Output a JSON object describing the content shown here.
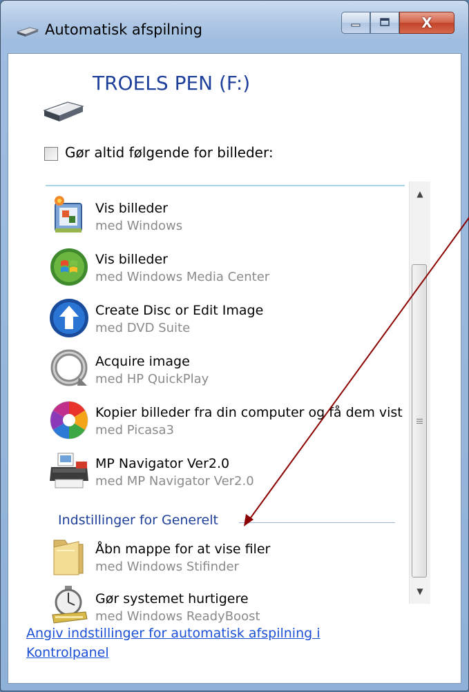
{
  "window": {
    "title": "Automatisk afspilning",
    "minimize_icon": "minimize-icon",
    "maximize_icon": "maximize-icon",
    "close_label": "X"
  },
  "device": {
    "name": "TROELS PEN (F:)",
    "icon": "usb-drive-icon"
  },
  "always_option": {
    "label": "Gør altid følgende for billeder:",
    "checked": false
  },
  "actions": [
    {
      "title": "Vis billeder",
      "subtitle": "med Windows",
      "icon": "photo-gallery-icon"
    },
    {
      "title": "Vis billeder",
      "subtitle": "med Windows Media Center",
      "icon": "media-center-icon"
    },
    {
      "title": "Create Disc or Edit Image",
      "subtitle": "med DVD Suite",
      "icon": "dvd-suite-icon"
    },
    {
      "title": "Acquire image",
      "subtitle": "med HP QuickPlay",
      "icon": "hp-quickplay-icon"
    },
    {
      "title": "Kopier billeder fra din computer og få dem vist",
      "subtitle": "med Picasa3",
      "icon": "picasa-icon"
    },
    {
      "title": "MP Navigator Ver2.0",
      "subtitle": "med MP Navigator Ver2.0",
      "icon": "printer-scanner-icon"
    }
  ],
  "general_section": {
    "header": "Indstillinger for Generelt",
    "items": [
      {
        "title": "Åbn mappe for at vise filer",
        "subtitle": "med Windows Stifinder",
        "icon": "folder-icon"
      },
      {
        "title": "Gør systemet hurtigere",
        "subtitle": "med Windows ReadyBoost",
        "icon": "readyboost-stopwatch-icon"
      }
    ]
  },
  "footer_link": "Angiv indstillinger for automatisk afspilning i Kontrolpanel",
  "colors": {
    "accent_text": "#1e3f9a",
    "link": "#1a4fd6",
    "annotation_arrow": "#8b0000"
  }
}
